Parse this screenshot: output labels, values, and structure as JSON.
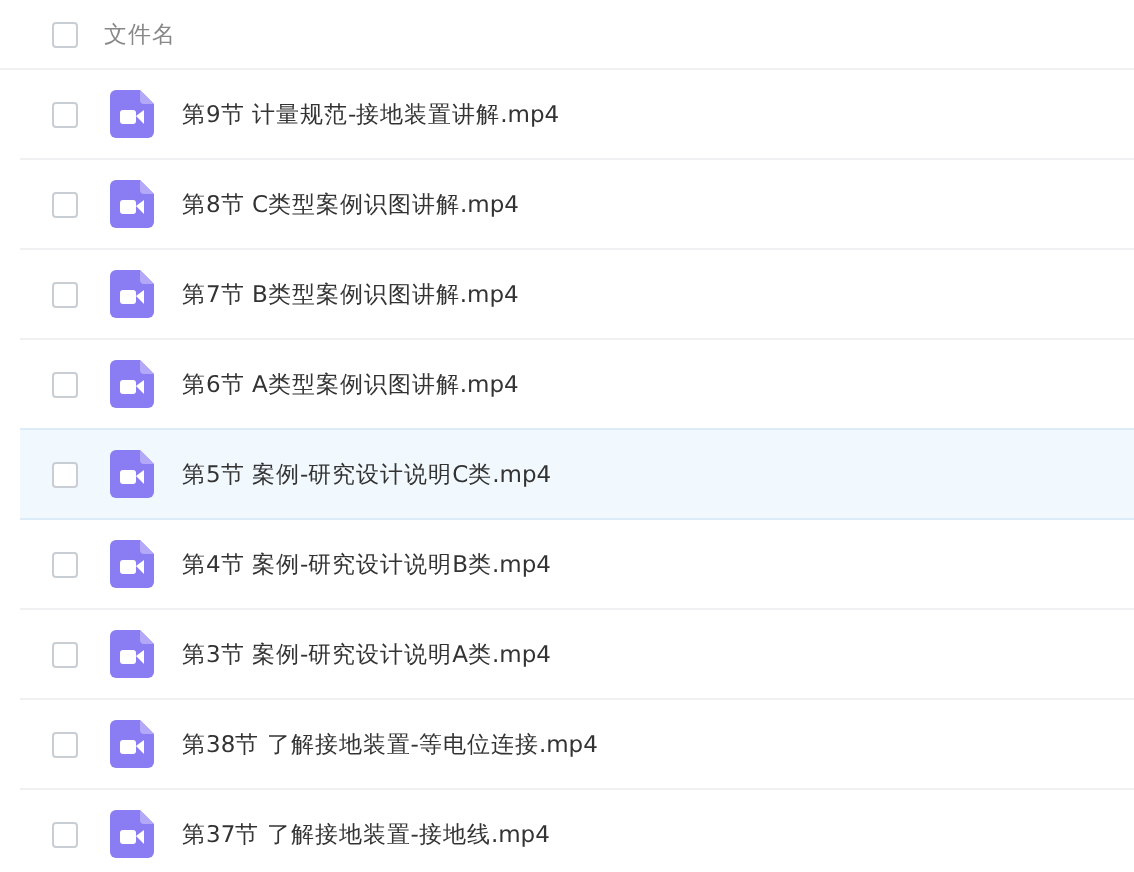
{
  "header": {
    "label": "文件名",
    "checked": false
  },
  "files": [
    {
      "name": "第9节 计量规范-接地装置讲解.mp4",
      "checked": false,
      "hovered": false
    },
    {
      "name": "第8节 C类型案例识图讲解.mp4",
      "checked": false,
      "hovered": false
    },
    {
      "name": "第7节 B类型案例识图讲解.mp4",
      "checked": false,
      "hovered": false
    },
    {
      "name": "第6节 A类型案例识图讲解.mp4",
      "checked": false,
      "hovered": false
    },
    {
      "name": "第5节 案例-研究设计说明C类.mp4",
      "checked": false,
      "hovered": true
    },
    {
      "name": "第4节 案例-研究设计说明B类.mp4",
      "checked": false,
      "hovered": false
    },
    {
      "name": "第3节 案例-研究设计说明A类.mp4",
      "checked": false,
      "hovered": false
    },
    {
      "name": "第38节 了解接地装置-等电位连接.mp4",
      "checked": false,
      "hovered": false
    },
    {
      "name": "第37节 了解接地装置-接地线.mp4",
      "checked": false,
      "hovered": false
    }
  ]
}
